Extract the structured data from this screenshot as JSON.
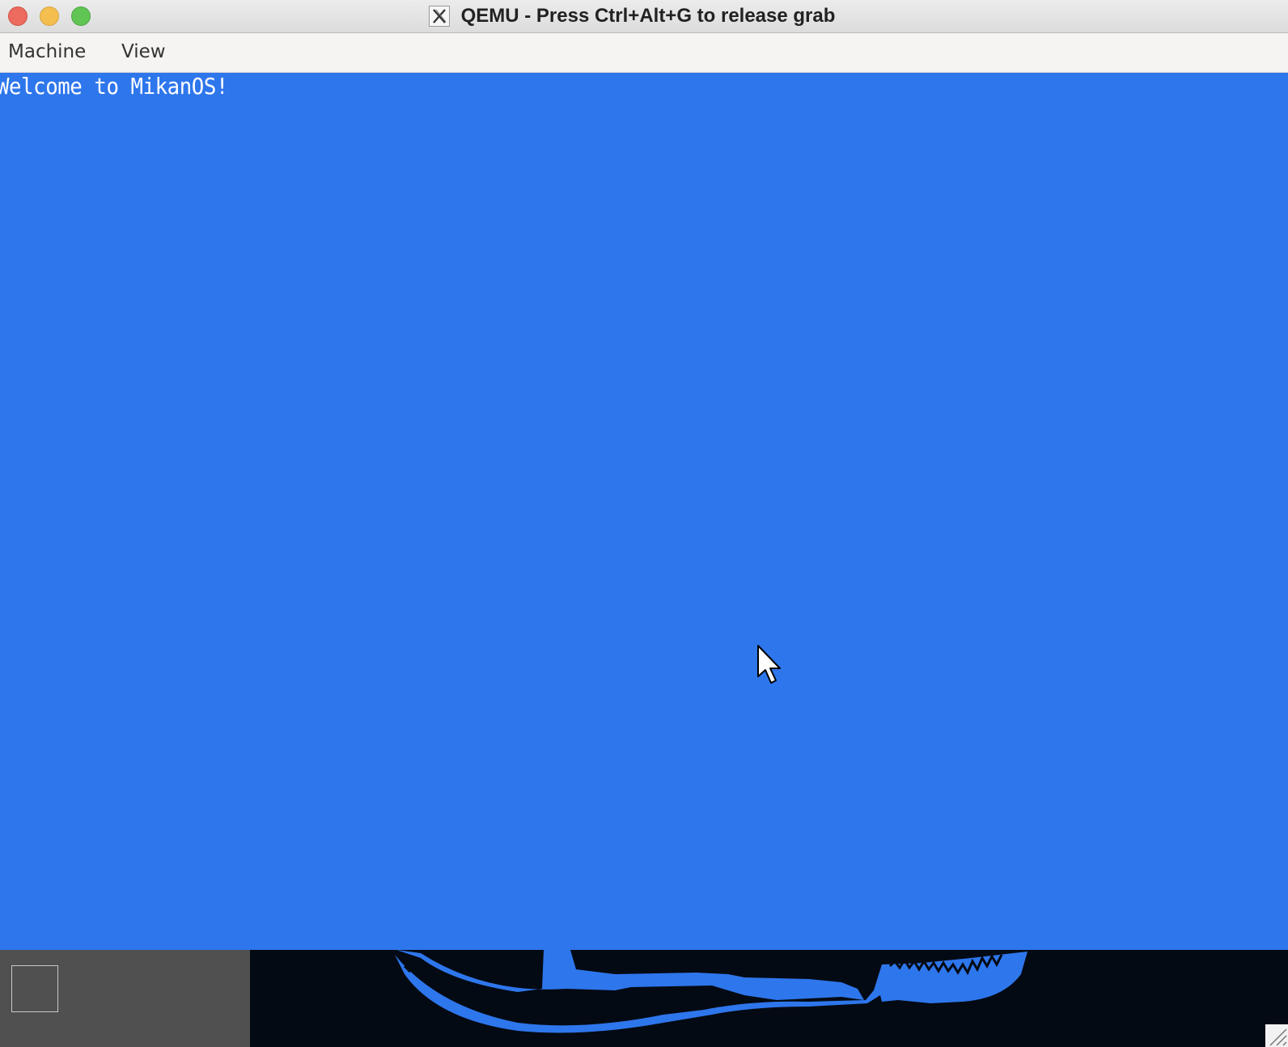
{
  "window": {
    "title": "QEMU - Press Ctrl+Alt+G to release grab",
    "app_icon": "x11-icon",
    "controls": [
      "close-button",
      "minimize-button",
      "maximize-button"
    ]
  },
  "menubar": {
    "items": [
      {
        "label": "Machine"
      },
      {
        "label": "View"
      }
    ]
  },
  "guest": {
    "desktop_color": "#2e76ec",
    "taskbar_color": "#040a14",
    "taskbar_left_color": "#505050",
    "console_text": "Welcome to MikanOS!",
    "pointer": "mouse-cursor-icon"
  }
}
